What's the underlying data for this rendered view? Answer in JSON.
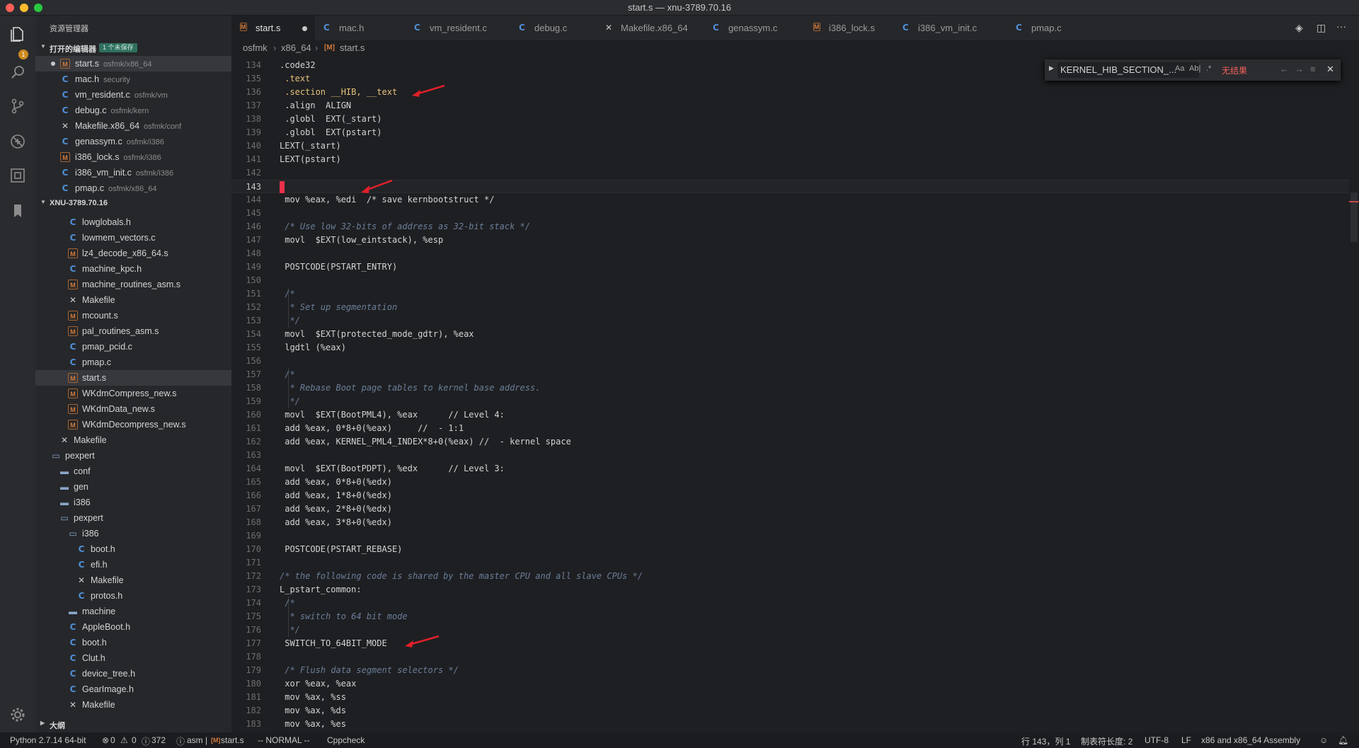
{
  "window": {
    "title": "start.s — xnu-3789.70.16"
  },
  "activity_bar": {
    "badge": "1"
  },
  "sidebar": {
    "title": "资源管理器",
    "open_editors": {
      "label": "打开的编辑器",
      "unsaved_badge": "1 个未保存",
      "items": [
        {
          "name": "start.s",
          "path": "osfmk/x86_64",
          "icon": "asm-file-icon"
        },
        {
          "name": "mac.h",
          "path": "security",
          "icon": "c-file-icon"
        },
        {
          "name": "vm_resident.c",
          "path": "osfmk/vm",
          "icon": "c-file-icon"
        },
        {
          "name": "debug.c",
          "path": "osfmk/kern",
          "icon": "c-file-icon"
        },
        {
          "name": "Makefile.x86_64",
          "path": "osfmk/conf",
          "icon": "makefile-icon"
        },
        {
          "name": "genassym.c",
          "path": "osfmk/i386",
          "icon": "c-file-icon"
        },
        {
          "name": "i386_lock.s",
          "path": "osfmk/i386",
          "icon": "asm-file-icon"
        },
        {
          "name": "i386_vm_init.c",
          "path": "osfmk/i386",
          "icon": "c-file-icon"
        },
        {
          "name": "pmap.c",
          "path": "osfmk/x86_64",
          "icon": "c-file-icon"
        }
      ]
    },
    "workspace": {
      "label": "XNU-3789.70.16",
      "items": [
        {
          "name": "lowglobals.h",
          "icon": "c-file-icon"
        },
        {
          "name": "lowmem_vectors.c",
          "icon": "c-file-icon"
        },
        {
          "name": "lz4_decode_x86_64.s",
          "icon": "asm-file-icon"
        },
        {
          "name": "machine_kpc.h",
          "icon": "c-file-icon"
        },
        {
          "name": "machine_routines_asm.s",
          "icon": "asm-file-icon"
        },
        {
          "name": "Makefile",
          "icon": "makefile-icon"
        },
        {
          "name": "mcount.s",
          "icon": "asm-file-icon"
        },
        {
          "name": "pal_routines_asm.s",
          "icon": "asm-file-icon"
        },
        {
          "name": "pmap_pcid.c",
          "icon": "c-file-icon"
        },
        {
          "name": "pmap.c",
          "icon": "c-file-icon"
        },
        {
          "name": "start.s",
          "icon": "asm-file-icon"
        },
        {
          "name": "WKdmCompress_new.s",
          "icon": "asm-file-icon"
        },
        {
          "name": "WKdmData_new.s",
          "icon": "asm-file-icon"
        },
        {
          "name": "WKdmDecompress_new.s",
          "icon": "asm-file-icon"
        },
        {
          "name": "Makefile",
          "icon": "makefile-icon"
        },
        {
          "name": "pexpert",
          "icon": "folder-open-icon"
        },
        {
          "name": "conf",
          "icon": "folder-icon"
        },
        {
          "name": "gen",
          "icon": "folder-icon"
        },
        {
          "name": "i386",
          "icon": "folder-icon"
        },
        {
          "name": "pexpert",
          "icon": "folder-open-icon"
        },
        {
          "name": "i386",
          "icon": "folder-open-icon"
        },
        {
          "name": "boot.h",
          "icon": "c-file-icon"
        },
        {
          "name": "efi.h",
          "icon": "c-file-icon"
        },
        {
          "name": "Makefile",
          "icon": "makefile-icon"
        },
        {
          "name": "protos.h",
          "icon": "c-file-icon"
        },
        {
          "name": "machine",
          "icon": "folder-icon"
        },
        {
          "name": "AppleBoot.h",
          "icon": "c-file-icon"
        },
        {
          "name": "boot.h",
          "icon": "c-file-icon"
        },
        {
          "name": "Clut.h",
          "icon": "c-file-icon"
        },
        {
          "name": "device_tree.h",
          "icon": "c-file-icon"
        },
        {
          "name": "GearImage.h",
          "icon": "c-file-icon"
        },
        {
          "name": "Makefile",
          "icon": "makefile-icon"
        }
      ]
    },
    "outline": {
      "label": "大纲"
    }
  },
  "tabs": [
    {
      "label": "start.s",
      "icon": "asm-file-icon"
    },
    {
      "label": "mac.h",
      "icon": "c-file-icon"
    },
    {
      "label": "vm_resident.c",
      "icon": "c-file-icon"
    },
    {
      "label": "debug.c",
      "icon": "c-file-icon"
    },
    {
      "label": "Makefile.x86_64",
      "icon": "makefile-icon"
    },
    {
      "label": "genassym.c",
      "icon": "c-file-icon"
    },
    {
      "label": "i386_lock.s",
      "icon": "asm-file-icon"
    },
    {
      "label": "i386_vm_init.c",
      "icon": "c-file-icon"
    },
    {
      "label": "pmap.c",
      "icon": "c-file-icon"
    }
  ],
  "tab_actions": {
    "split": "⇄",
    "more": "···"
  },
  "breadcrumb": [
    "osfmk",
    "x86_64",
    "start.s"
  ],
  "find_widget": {
    "query": "KERNEL_HIB_SECTION_...",
    "opt_case": "Aa",
    "opt_word": "Ab|",
    "opt_regex": ".*",
    "result": "无结果",
    "prev": "←",
    "next": "→",
    "selection": "≡",
    "close": "✕"
  },
  "editor": {
    "lines": [
      {
        "n": "134",
        "t": ".code32"
      },
      {
        "n": "135",
        "t": " .text"
      },
      {
        "n": "136",
        "t": " .section __HIB, __text"
      },
      {
        "n": "137",
        "t": " .align  ALIGN"
      },
      {
        "n": "138",
        "t": " .globl  EXT(_start)"
      },
      {
        "n": "139",
        "t": " .globl  EXT(pstart)"
      },
      {
        "n": "140",
        "t": "LEXT(_start)"
      },
      {
        "n": "141",
        "t": "LEXT(pstart)"
      },
      {
        "n": "142",
        "t": ""
      },
      {
        "n": "143",
        "t": ""
      },
      {
        "n": "144",
        "t": " mov %eax, %edi  /* save kernbootstruct */"
      },
      {
        "n": "145",
        "t": ""
      },
      {
        "n": "146",
        "t": " /* Use low 32-bits of address as 32-bit stack */"
      },
      {
        "n": "147",
        "t": " movl  $EXT(low_eintstack), %esp"
      },
      {
        "n": "148",
        "t": ""
      },
      {
        "n": "149",
        "t": " POSTCODE(PSTART_ENTRY)"
      },
      {
        "n": "150",
        "t": ""
      },
      {
        "n": "151",
        "t": " /*"
      },
      {
        "n": "152",
        "t": "  * Set up segmentation"
      },
      {
        "n": "153",
        "t": "  */"
      },
      {
        "n": "154",
        "t": " movl  $EXT(protected_mode_gdtr), %eax"
      },
      {
        "n": "155",
        "t": " lgdtl (%eax)"
      },
      {
        "n": "156",
        "t": ""
      },
      {
        "n": "157",
        "t": " /*"
      },
      {
        "n": "158",
        "t": "  * Rebase Boot page tables to kernel base address."
      },
      {
        "n": "159",
        "t": "  */"
      },
      {
        "n": "160",
        "t": " movl  $EXT(BootPML4), %eax      // Level 4:"
      },
      {
        "n": "161",
        "t": " add %eax, 0*8+0(%eax)     //  - 1:1"
      },
      {
        "n": "162",
        "t": " add %eax, KERNEL_PML4_INDEX*8+0(%eax) //  - kernel space"
      },
      {
        "n": "163",
        "t": ""
      },
      {
        "n": "164",
        "t": " movl  $EXT(BootPDPT), %edx      // Level 3:"
      },
      {
        "n": "165",
        "t": " add %eax, 0*8+0(%edx)"
      },
      {
        "n": "166",
        "t": " add %eax, 1*8+0(%edx)"
      },
      {
        "n": "167",
        "t": " add %eax, 2*8+0(%edx)"
      },
      {
        "n": "168",
        "t": " add %eax, 3*8+0(%edx)"
      },
      {
        "n": "169",
        "t": ""
      },
      {
        "n": "170",
        "t": " POSTCODE(PSTART_REBASE)"
      },
      {
        "n": "171",
        "t": ""
      },
      {
        "n": "172",
        "t": "/* the following code is shared by the master CPU and all slave CPUs */"
      },
      {
        "n": "173",
        "t": "L_pstart_common:"
      },
      {
        "n": "174",
        "t": " /*"
      },
      {
        "n": "175",
        "t": "  * switch to 64 bit mode"
      },
      {
        "n": "176",
        "t": "  */"
      },
      {
        "n": "177",
        "t": " SWITCH_TO_64BIT_MODE"
      },
      {
        "n": "178",
        "t": ""
      },
      {
        "n": "179",
        "t": " /* Flush data segment selectors */"
      },
      {
        "n": "180",
        "t": " xor %eax, %eax"
      },
      {
        "n": "181",
        "t": " mov %ax, %ss"
      },
      {
        "n": "182",
        "t": " mov %ax, %ds"
      },
      {
        "n": "183",
        "t": " mov %ax, %es"
      }
    ]
  },
  "statusbar": {
    "python": "Python 2.7.14 64-bit",
    "errors": "0",
    "warnings": "0",
    "infos": "372",
    "language_short": "asm",
    "file": "start.s",
    "vim_mode": "-- NORMAL --",
    "linter": "Cppcheck",
    "position": "行 143，列 1",
    "tab_size": "制表符长度: 2",
    "encoding": "UTF-8",
    "eol": "LF",
    "language": "x86 and x86_64 Assembly"
  },
  "colors": {
    "accent_red": "#e8304a",
    "comment": "#6a7e99",
    "keyword": "#e06c75",
    "function": "#e6c07b"
  }
}
